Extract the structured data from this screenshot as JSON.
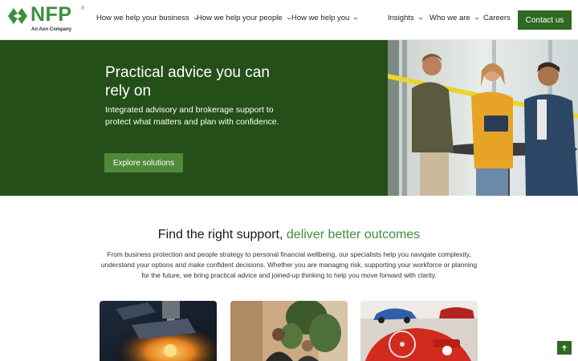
{
  "brand": {
    "name": "NFP",
    "tagline": "An Aon Company",
    "color": "#3e8e3e"
  },
  "nav": {
    "items": [
      {
        "label": "How we help your business",
        "has_dropdown": true
      },
      {
        "label": "How we help your people",
        "has_dropdown": true
      },
      {
        "label": "How we help you",
        "has_dropdown": true
      },
      {
        "label": "Insights",
        "has_dropdown": true
      },
      {
        "label": "Who we are",
        "has_dropdown": true
      },
      {
        "label": "Careers",
        "has_dropdown": false
      }
    ],
    "contact_label": "Contact us"
  },
  "hero": {
    "title": "Practical advice you can rely on",
    "text": "Integrated advisory and brokerage support to protect what matters and plan with confidence.",
    "button_label": "Explore solutions",
    "bg_color": "#254f19"
  },
  "section": {
    "title_main": "Find the right support,",
    "title_accent": "deliver better outcomes",
    "text": "From business protection and people strategy to personal financial wellbeing, our specialists help you navigate complexity, understand your options and make confident decisions. Whether you are managing risk, supporting your workforce or planning for the future, we bring practical advice and joined-up thinking to help you move forward with clarity."
  },
  "cards": [
    {
      "image": "industrial-machinery-photo"
    },
    {
      "image": "people-meeting-photo"
    },
    {
      "image": "classic-cars-photo"
    }
  ],
  "icons": {
    "logo": "nfp-leaf-icon",
    "dropdown": "chevron-down-icon",
    "back_to_top": "arrow-up-icon"
  }
}
